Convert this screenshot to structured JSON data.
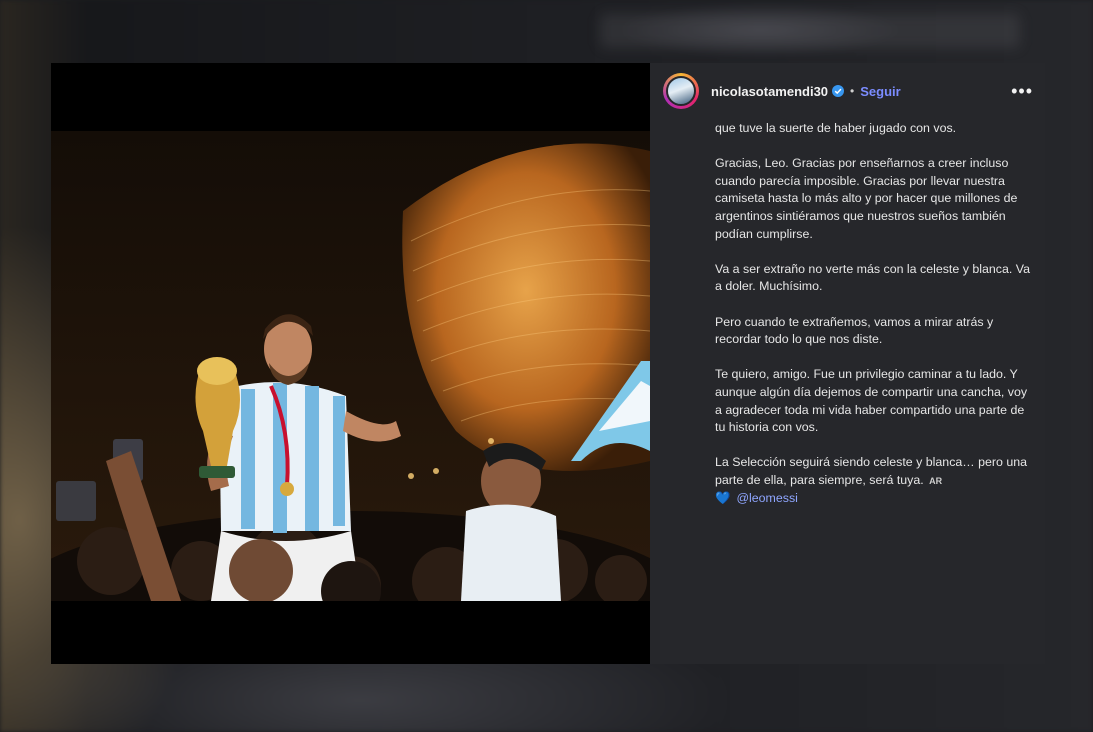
{
  "post": {
    "username": "nicolasotamendi30",
    "separator": "•",
    "follow_label": "Seguir",
    "more_label": "•••",
    "caption": [
      "que tuve la suerte de haber jugado con vos.",
      "Gracias, Leo. Gracias por enseñarnos a creer incluso cuando parecía imposible. Gracias por llevar nuestra camiseta hasta lo más alto y por hacer que millones de argentinos sintiéramos que nuestros sueños también podían cumplirse.",
      "Va a ser extraño no verte más con la celeste y blanca. Va a doler. Muchísimo.",
      "Pero cuando te extrañemos, vamos a mirar atrás y recordar todo lo que nos diste.",
      "Te quiero, amigo. Fue un privilegio caminar a tu lado. Y aunque algún día dejemos de compartir una cancha, voy a agradecer toda mi vida haber compartido una parte de tu historia con vos.",
      "La Selección seguirá siendo celeste y blanca… pero una parte de ella, para siempre, será tuya."
    ],
    "flag_label": "AR",
    "heart_glyph": "💙",
    "mention": "@leomessi"
  },
  "icons": {
    "verified": "verified-badge-icon",
    "more": "more-options-icon"
  },
  "colors": {
    "panel_bg": "#26272b",
    "link": "#7b8cff",
    "verified": "#3897f0"
  }
}
